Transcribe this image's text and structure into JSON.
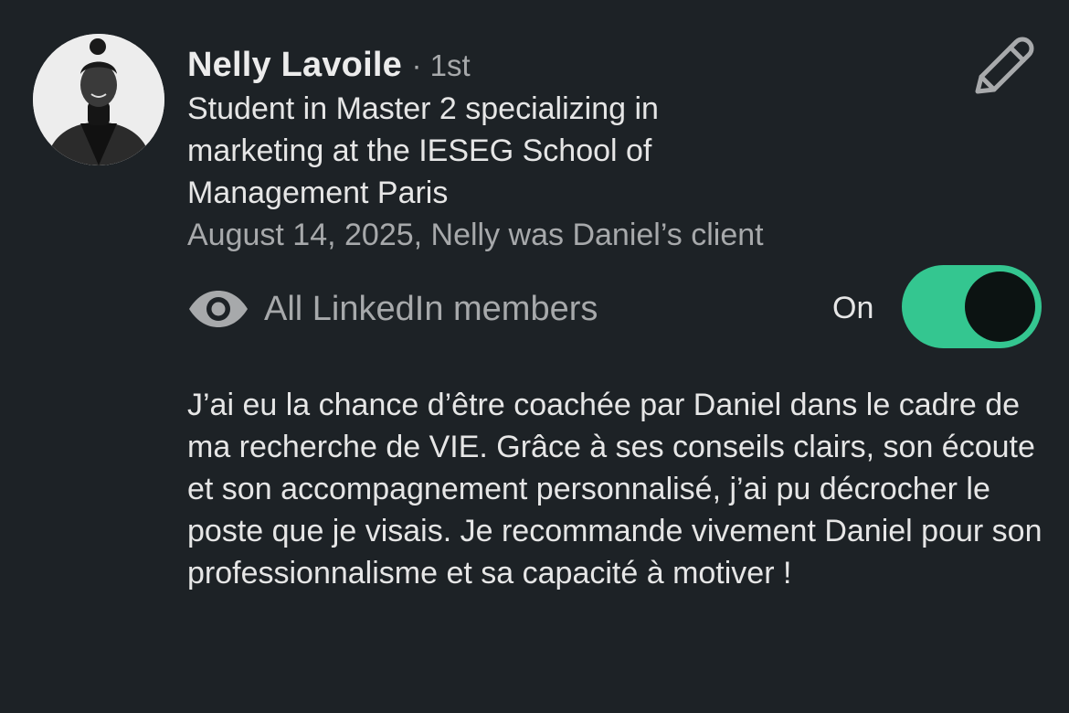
{
  "recommendation": {
    "author": {
      "name": "Nelly Lavoile",
      "degree": "· 1st",
      "headline": "Student in Master 2 specializing in marketing at the IESEG School of Management Paris",
      "meta": "August 14, 2025, Nelly was Daniel’s client",
      "avatar_icon": "profile-photo"
    },
    "edit_icon": "pencil-icon",
    "visibility": {
      "icon": "eye-icon",
      "label": "All LinkedIn members",
      "toggle_label": "On",
      "toggle_on": true,
      "toggle_color": "#34c690"
    },
    "text": "J’ai eu la chance d’être coachée par Daniel dans le cadre de ma recherche de VIE. Grâce à ses conseils clairs, son écoute et son accompagnement personnalisé, j’ai pu décrocher le poste que je visais. Je recommande vivement Daniel pour son professionnalisme et sa capacité à motiver !"
  }
}
